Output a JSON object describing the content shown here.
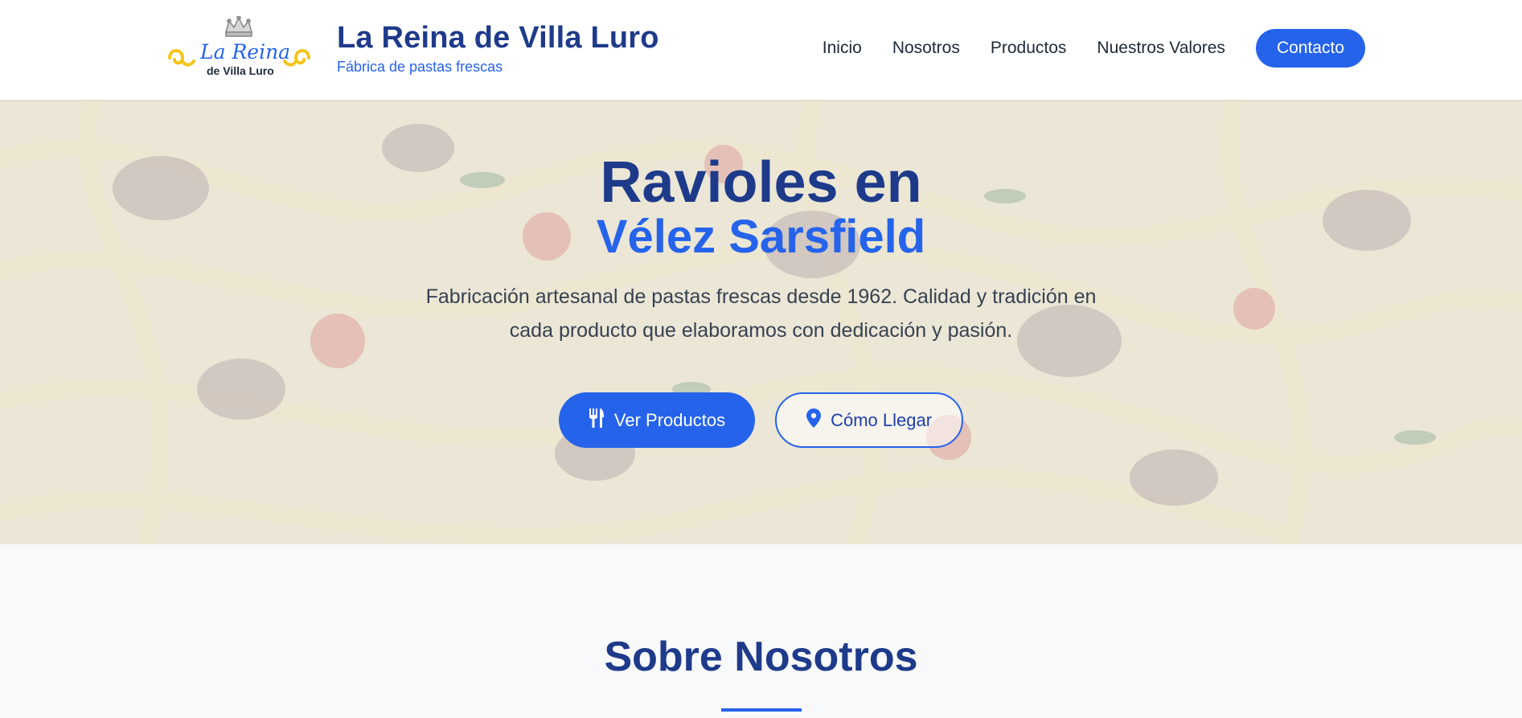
{
  "header": {
    "logo": {
      "text_main": "La Reina",
      "text_sub": "de Villa Luro",
      "icon": "crown-icon"
    },
    "brand_title": "La Reina de Villa Luro",
    "brand_subtitle": "Fábrica de pastas frescas",
    "nav": [
      {
        "label": "Inicio"
      },
      {
        "label": "Nosotros"
      },
      {
        "label": "Productos"
      },
      {
        "label": "Nuestros Valores"
      }
    ],
    "cta_label": "Contacto"
  },
  "hero": {
    "title_line1": "Ravioles en",
    "title_line2": "Vélez Sarsfield",
    "description": "Fabricación artesanal de pastas frescas desde 1962. Calidad y tradición en cada producto que elaboramos con dedicación y pasión.",
    "primary_button": {
      "label": "Ver Productos",
      "icon": "utensils-icon"
    },
    "secondary_button": {
      "label": "Cómo Llegar",
      "icon": "map-pin-icon"
    }
  },
  "about": {
    "title": "Sobre Nosotros"
  },
  "colors": {
    "brand_dark": "#1e3a8a",
    "brand_blue": "#2563eb",
    "logo_gold": "#f5c518",
    "text": "#1f2937"
  }
}
